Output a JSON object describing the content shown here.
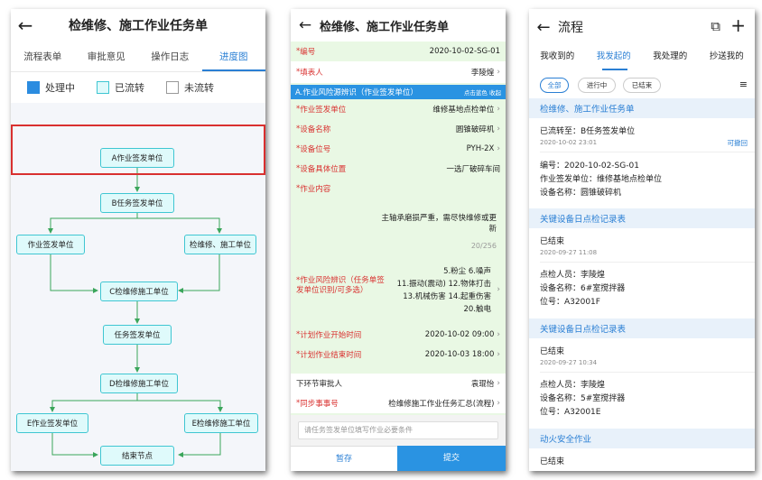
{
  "p1": {
    "title": "检维修、施工作业任务单",
    "tabs": [
      "流程表单",
      "审批意见",
      "操作日志",
      "进度图"
    ],
    "legend": [
      "处理中",
      "已流转",
      "未流转"
    ],
    "colors": {
      "processing": "#2b8ce0",
      "flowed": "#dffafb",
      "not_flowed": "#ffffff",
      "highlight": "#d9302f"
    },
    "nodes": {
      "a": "A作业签发单位",
      "b": "B任务签发单位",
      "left1": "作业签发单位",
      "right1": "检维修、施工单位",
      "c": "C检维修施工单位",
      "task": "任务签发单位",
      "d": "D检维修施工单位",
      "e_left": "E作业签发单位",
      "e_right": "E检维修施工单位",
      "end": "结束节点"
    }
  },
  "p2": {
    "title": "检维修、施工作业任务单",
    "number_label": "编号",
    "number": "2020-10-02-SG-01",
    "filler_label": "填表人",
    "filler": "李陵煌",
    "section_title": "A.作业风险源辨识（作业签发单位）",
    "section_action": "点击蓝色 收起",
    "rows": [
      {
        "label": "作业签发单位",
        "value": "维修基地点检单位"
      },
      {
        "label": "设备名称",
        "value": "圆锥破碎机"
      },
      {
        "label": "设备位号",
        "value": "PYH-2X"
      },
      {
        "label": "设备具体位置",
        "value": "一选厂破碎车间"
      }
    ],
    "content_label": "作业内容",
    "content_text": "主轴承磨损严重，需尽快维修或更新",
    "content_count": "20/256",
    "risk_label": "作业风险辨识（任务单签发单位识别/可多选）",
    "risk_values": [
      "5.粉尘 6.噪声",
      "11.振动(震动) 12.物体打击",
      "13.机械伤害 14.起重伤害",
      "20.触电"
    ],
    "start_label": "计划作业开始时间",
    "start_value": "2020-10-02 09:00",
    "end_label": "计划作业结束时间",
    "end_value": "2020-10-03 18:00",
    "approver_label": "下环节审批人",
    "approver": "袁琨怡",
    "sync_label": "同步事事号",
    "sync_value": "检维修施工作业任务汇总(流程)",
    "input_placeholder": "请任务签发单位填写作业必要条件",
    "save_label": "暂存",
    "submit_label": "提交"
  },
  "p3": {
    "title": "流程",
    "tabs": [
      "我收到的",
      "我发起的",
      "我处理的",
      "抄送我的"
    ],
    "filters": [
      "全部",
      "进行中",
      "已结束"
    ],
    "cards": [
      {
        "title": "检维修、施工作业任务单",
        "status": "已流转至：B任务签发单位",
        "time": "2020-10-02 23:01",
        "action": "可撤回",
        "lines": [
          "编号：2020-10-02-SG-01",
          "作业签发单位：维修基地点检单位",
          "设备名称：圆锥破碎机"
        ]
      },
      {
        "title": "关键设备日点检记录表",
        "status": "已结束",
        "time": "2020-09-27 11:08",
        "lines": [
          "点检人员：李陵煌",
          "设备名称：6#室搅拌器",
          "位号：A32001F"
        ]
      },
      {
        "title": "关键设备日点检记录表",
        "status": "已结束",
        "time": "2020-09-27 10:34",
        "lines": [
          "点检人员：李陵煌",
          "设备名称：5#室搅拌器",
          "位号：A32001E"
        ]
      },
      {
        "title": "动火安全作业",
        "status": "已结束"
      }
    ]
  }
}
